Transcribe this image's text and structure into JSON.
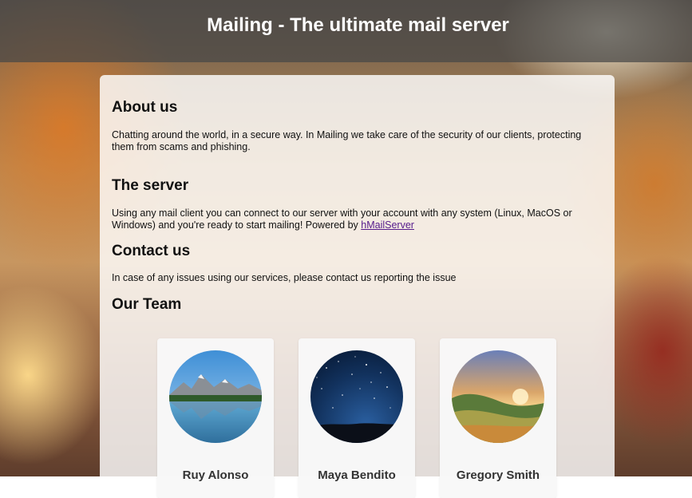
{
  "header": {
    "title": "Mailing - The ultimate mail server"
  },
  "about": {
    "heading": "About us",
    "text": "Chatting around the world, in a secure way. In Mailing we take care of the security of our clients, protecting them from scams and phishing."
  },
  "server": {
    "heading": "The server",
    "text": "Using any mail client you can connect to our server with your account with any system (Linux, MacOS or Windows) and you're ready to start mailing! Powered by ",
    "link_label": "hMailServer"
  },
  "contact": {
    "heading": "Contact us",
    "text": "In case of any issues using our services, please contact us reporting the issue"
  },
  "team": {
    "heading": "Our Team",
    "members": [
      {
        "name": "Ruy Alonso",
        "avatar": "mountain-lake-photo"
      },
      {
        "name": "Maya Bendito",
        "avatar": "starry-night-photo"
      },
      {
        "name": "Gregory Smith",
        "avatar": "sunset-hills-photo"
      }
    ]
  },
  "colors": {
    "header_bg": "#464646",
    "link": "#551a8b"
  }
}
